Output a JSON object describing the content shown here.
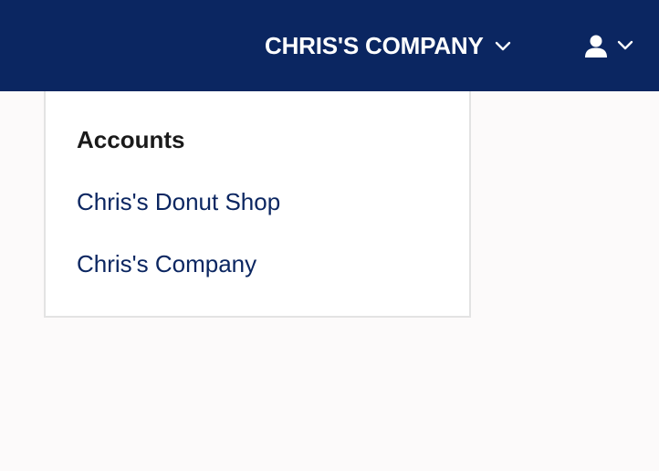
{
  "header": {
    "company_name": "CHRIS'S COMPANY",
    "company_chevron_icon": "chevron-down-icon",
    "user_icon": "user-icon",
    "user_chevron_icon": "chevron-down-icon",
    "background_color": "#0b2661",
    "text_color": "#ffffff"
  },
  "accounts_panel": {
    "heading": "Accounts",
    "items": [
      {
        "label": "Chris's Donut Shop"
      },
      {
        "label": "Chris's Company"
      }
    ],
    "link_color": "#0b2661"
  }
}
